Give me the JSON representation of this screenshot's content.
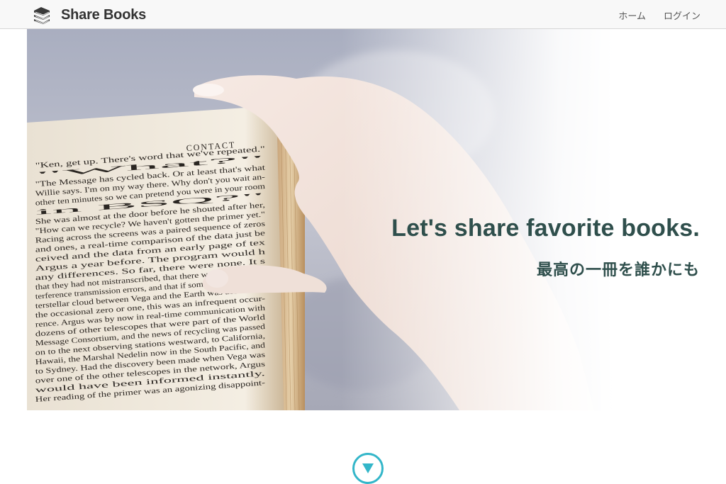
{
  "header": {
    "brand": "Share Books",
    "brand_icon": "books-stack-icon",
    "nav": [
      {
        "label": "ホーム"
      },
      {
        "label": "ログイン"
      }
    ]
  },
  "hero": {
    "heading": "Let's share favorite books.",
    "subheading": "最高の一冊を誰かにも",
    "book": {
      "chapter": "CONTACT",
      "lines": [
        "\"Ken, get up. There's word that we've repeated.\"",
        "\"What?\"",
        "\"The Message has cycled back. Or at least that's what",
        "Willie says. I'm on my way there. Why don't you wait an-",
        "other ten minutes so we can pretend you were in your room",
        "in BSQ?\"",
        "She was almost at the door before he shouted after her,",
        "\"How can we recycle? We haven't gotten the primer yet.\"",
        "Racing across the screens was a paired sequence of zeros",
        "and ones, a real-time comparison of the data just be",
        "ceived and the data from an early page of tex",
        "Argus a year before. The program would h",
        "any differences. So far, there were none. It s",
        "that they had not mistranscribed, that there was no dense in-",
        "terference transmission errors, and that if some small dense in-",
        "terstellar cloud between Vega and the Earth was able to eat",
        "the occasional zero or one, this was an infrequent occur-",
        "rence. Argus was by now in real-time communication with",
        "dozens of other telescopes that were part of the World",
        "Message Consortium, and the news of recycling was passed",
        "on to the next observing stations westward, to California,",
        "Hawaii, the Marshal Nedelin now in the South Pacific, and",
        "to Sydney. Had the discovery been made when Vega was",
        "over one of the other telescopes in the network, Argus",
        "would have been informed instantly.",
        "Her reading of the primer was an agonizing disappoint-"
      ]
    }
  },
  "scroll": {
    "icon": "triangle-down-icon",
    "color": "#33b6c9"
  },
  "colors": {
    "heading": "#2f4f4c",
    "header_bg": "#f8f8f8",
    "accent": "#33b6c9"
  }
}
